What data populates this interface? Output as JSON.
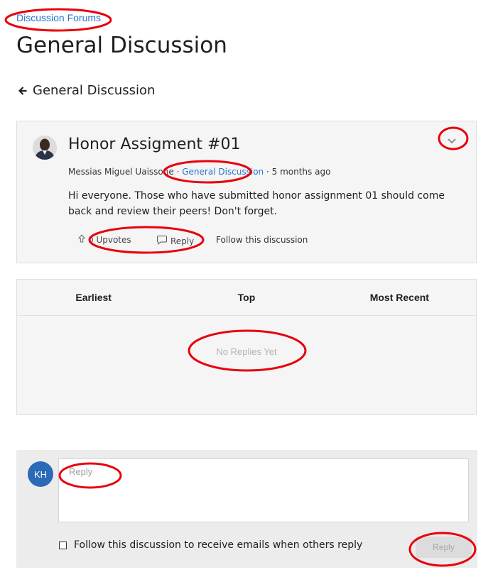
{
  "breadcrumb": {
    "label": "Discussion Forums"
  },
  "page": {
    "title": "General Discussion"
  },
  "back_link": {
    "label": "General Discussion"
  },
  "post": {
    "title": "Honor Assigment #01",
    "author": "Messias Miguel Uaissone",
    "forum": "General Discussion",
    "time": "5 months ago",
    "body": "Hi everyone. Those who have submitted honor assignment 01 should come back and review their peers! Don't forget.",
    "upvotes_label": "0 Upvotes",
    "reply_label": "Reply",
    "follow_label": "Follow this discussion"
  },
  "sort_tabs": [
    {
      "label": "Earliest"
    },
    {
      "label": "Top"
    },
    {
      "label": "Most Recent"
    }
  ],
  "replies": {
    "empty_message": "No Replies Yet"
  },
  "compose": {
    "user_initials": "KH",
    "placeholder": "Reply",
    "follow_checkbox_label": "Follow this discussion to receive emails when others reply",
    "follow_checked": false,
    "submit_label": "Reply"
  },
  "colors": {
    "link": "#2a73cc",
    "user_avatar": "#2b6ab8",
    "annotation": "#e8000b",
    "panel_background": "#f5f5f5"
  }
}
